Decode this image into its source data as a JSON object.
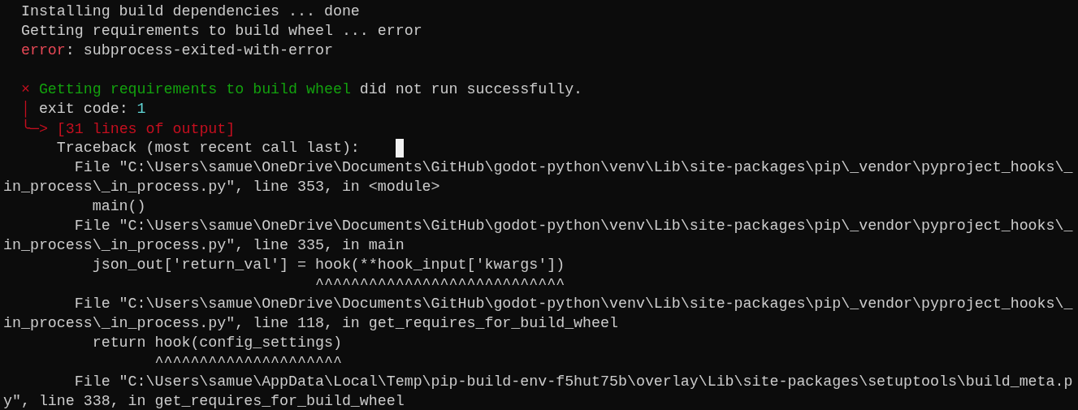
{
  "terminal": {
    "lines": [
      {
        "segments": [
          {
            "text": "  Installing build dependencies ... done",
            "kind": "plain"
          }
        ]
      },
      {
        "segments": [
          {
            "text": "  Getting requirements to build wheel ... error",
            "kind": "plain"
          }
        ]
      },
      {
        "segments": [
          {
            "text": "  error",
            "kind": "error"
          },
          {
            "text": ": subprocess-exited-with-error",
            "kind": "plain"
          }
        ]
      },
      {
        "kind": "blank"
      },
      {
        "segments": [
          {
            "text": "  × ",
            "kind": "alert"
          },
          {
            "text": "Getting requirements to build wheel",
            "kind": "success"
          },
          {
            "text": " did not run successfully.",
            "kind": "plain"
          }
        ]
      },
      {
        "segments": [
          {
            "text": "  │",
            "kind": "alert"
          },
          {
            "text": " exit code: ",
            "kind": "plain"
          },
          {
            "text": "1",
            "kind": "number"
          }
        ]
      },
      {
        "segments": [
          {
            "text": "  ╰─> [31 lines of output]",
            "kind": "alert"
          }
        ]
      },
      {
        "segments": [
          {
            "text": "      Traceback (most recent call last):",
            "kind": "plain"
          }
        ],
        "cursor": true
      },
      {
        "segments": [
          {
            "text": "        File \"C:\\Users\\samue\\OneDrive\\Documents\\GitHub\\godot-python\\venv\\Lib\\site-packages\\pip\\_vendor\\pyproject_hooks\\_",
            "kind": "plain"
          }
        ]
      },
      {
        "segments": [
          {
            "text": "in_process\\_in_process.py\", line 353, in <module>",
            "kind": "plain"
          }
        ]
      },
      {
        "segments": [
          {
            "text": "          main()",
            "kind": "plain"
          }
        ]
      },
      {
        "segments": [
          {
            "text": "        File \"C:\\Users\\samue\\OneDrive\\Documents\\GitHub\\godot-python\\venv\\Lib\\site-packages\\pip\\_vendor\\pyproject_hooks\\_",
            "kind": "plain"
          }
        ]
      },
      {
        "segments": [
          {
            "text": "in_process\\_in_process.py\", line 335, in main",
            "kind": "plain"
          }
        ]
      },
      {
        "segments": [
          {
            "text": "          json_out['return_val'] = hook(**hook_input['kwargs'])",
            "kind": "plain"
          }
        ]
      },
      {
        "segments": [
          {
            "text": "                                   ^^^^^^^^^^^^^^^^^^^^^^^^^^^^",
            "kind": "plain"
          }
        ]
      },
      {
        "segments": [
          {
            "text": "        File \"C:\\Users\\samue\\OneDrive\\Documents\\GitHub\\godot-python\\venv\\Lib\\site-packages\\pip\\_vendor\\pyproject_hooks\\_",
            "kind": "plain"
          }
        ]
      },
      {
        "segments": [
          {
            "text": "in_process\\_in_process.py\", line 118, in get_requires_for_build_wheel",
            "kind": "plain"
          }
        ]
      },
      {
        "segments": [
          {
            "text": "          return hook(config_settings)",
            "kind": "plain"
          }
        ]
      },
      {
        "segments": [
          {
            "text": "                 ^^^^^^^^^^^^^^^^^^^^^",
            "kind": "plain"
          }
        ]
      },
      {
        "segments": [
          {
            "text": "        File \"C:\\Users\\samue\\AppData\\Local\\Temp\\pip-build-env-f5hut75b\\overlay\\Lib\\site-packages\\setuptools\\build_meta.p",
            "kind": "plain"
          }
        ]
      },
      {
        "segments": [
          {
            "text": "y\", line 338, in get_requires_for_build_wheel",
            "kind": "plain"
          }
        ]
      }
    ]
  }
}
